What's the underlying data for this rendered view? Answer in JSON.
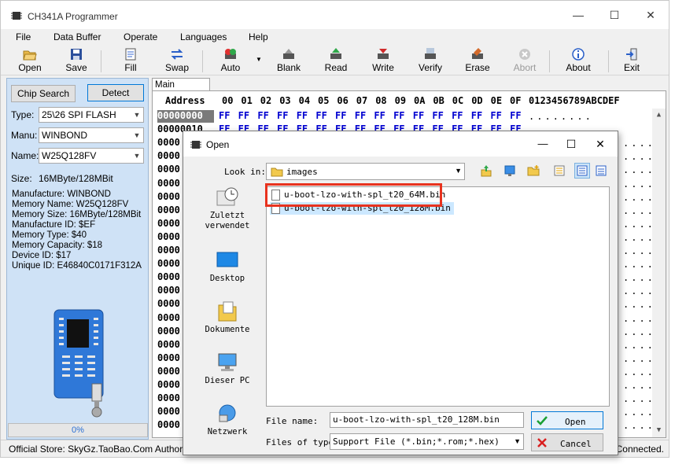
{
  "app": {
    "title": "CH341A Programmer",
    "window_buttons": {
      "minimize": "—",
      "maximize": "☐",
      "close": "✕"
    }
  },
  "menu": [
    "File",
    "Data Buffer",
    "Operate",
    "Languages",
    "Help"
  ],
  "toolbar": [
    {
      "label": "Open",
      "icon": "folder-open-icon",
      "enabled": true
    },
    {
      "label": "Save",
      "icon": "floppy-icon",
      "enabled": true
    },
    {
      "label": "Fill",
      "icon": "fill-icon",
      "enabled": true
    },
    {
      "label": "Swap",
      "icon": "swap-arrows-icon",
      "enabled": true
    },
    {
      "label": "Auto",
      "icon": "auto-chip-icon",
      "enabled": true
    },
    {
      "label": "Blank",
      "icon": "blank-chip-icon",
      "enabled": true
    },
    {
      "label": "Read",
      "icon": "read-chip-icon",
      "enabled": true
    },
    {
      "label": "Write",
      "icon": "write-chip-icon",
      "enabled": true
    },
    {
      "label": "Verify",
      "icon": "verify-chip-icon",
      "enabled": true
    },
    {
      "label": "Erase",
      "icon": "erase-chip-icon",
      "enabled": true
    },
    {
      "label": "Abort",
      "icon": "abort-icon",
      "enabled": false
    },
    {
      "label": "About",
      "icon": "info-icon",
      "enabled": true
    },
    {
      "label": "Exit",
      "icon": "exit-icon",
      "enabled": true
    }
  ],
  "left_panel": {
    "chip_search": "Chip Search",
    "detect": "Detect",
    "type_label": "Type:",
    "type_value": "25\\26 SPI FLASH",
    "manu_label": "Manu:",
    "manu_value": "WINBOND",
    "name_label": "Name:",
    "name_value": "W25Q128FV",
    "size_label": "Size:",
    "size_value": "16MByte/128MBit",
    "info_lines": [
      "Manufacture: WINBOND",
      "Memory Name: W25Q128FV",
      "Memory Size: 16MByte/128MBit",
      "Manufacture ID: $EF",
      "Memory Type: $40",
      "Memory Capacity: $18",
      "Device ID: $17",
      "Unique ID: E46840C0171F312A"
    ],
    "progress_text": "0%",
    "progress_value": 0
  },
  "hex": {
    "tab": "Main Memory",
    "address_header": "Address",
    "columns": [
      "00",
      "01",
      "02",
      "03",
      "04",
      "05",
      "06",
      "07",
      "08",
      "09",
      "0A",
      "0B",
      "0C",
      "0D",
      "0E",
      "0F"
    ],
    "ascii_header": "0123456789ABCDEF",
    "rows": [
      {
        "addr": "00000000",
        "bytes": "FF FF FF FF FF FF FF FF FF FF FF FF FF FF FF FF",
        "ascii": "........"
      },
      {
        "addr": "00000010",
        "bytes": "FF FF FF FF FF FF FF FF FF FF FF FF FF FF FF FF",
        "ascii": "........"
      },
      {
        "addr": "0000",
        "bytes": "",
        "ascii": "....."
      },
      {
        "addr": "0000",
        "bytes": "",
        "ascii": "....."
      },
      {
        "addr": "0000",
        "bytes": "",
        "ascii": "....."
      },
      {
        "addr": "0000",
        "bytes": "",
        "ascii": "....."
      },
      {
        "addr": "0000",
        "bytes": "",
        "ascii": "....."
      },
      {
        "addr": "0000",
        "bytes": "",
        "ascii": "....."
      },
      {
        "addr": "0000",
        "bytes": "",
        "ascii": "....."
      },
      {
        "addr": "0000",
        "bytes": "",
        "ascii": "....."
      },
      {
        "addr": "0000",
        "bytes": "",
        "ascii": "....."
      },
      {
        "addr": "0000",
        "bytes": "",
        "ascii": "....."
      },
      {
        "addr": "0000",
        "bytes": "",
        "ascii": "....."
      },
      {
        "addr": "0000",
        "bytes": "",
        "ascii": "....."
      },
      {
        "addr": "0000",
        "bytes": "",
        "ascii": "....."
      },
      {
        "addr": "0000",
        "bytes": "",
        "ascii": "....."
      },
      {
        "addr": "0000",
        "bytes": "",
        "ascii": "....."
      },
      {
        "addr": "0000",
        "bytes": "",
        "ascii": "....."
      },
      {
        "addr": "0000",
        "bytes": "",
        "ascii": "....."
      },
      {
        "addr": "0000",
        "bytes": "",
        "ascii": "....."
      },
      {
        "addr": "0000",
        "bytes": "",
        "ascii": "....."
      },
      {
        "addr": "0000",
        "bytes": "",
        "ascii": "....."
      },
      {
        "addr": "0000",
        "bytes": "",
        "ascii": "....."
      },
      {
        "addr": "0000",
        "bytes": "",
        "ascii": "....."
      }
    ]
  },
  "status": {
    "left": "Official Store: SkyGz.TaoBao.Com Author: Cam",
    "right": "Connected."
  },
  "dialog": {
    "title": "Open",
    "look_in_label": "Look in:",
    "look_in_value": "images",
    "places": [
      "Zuletzt\nverwendet",
      "Desktop",
      "Dokumente",
      "Dieser PC",
      "Netzwerk"
    ],
    "files": [
      "u-boot-lzo-with-spl_t20_64M.bin",
      "u-boot-lzo-with-spl_t20_128M.bin"
    ],
    "file_name_label": "File name:",
    "file_name_value": "u-boot-lzo-with-spl_t20_128M.bin",
    "file_type_label": "Files of type",
    "file_type_value": "Support File (*.bin;*.rom;*.hex)",
    "open_button": "Open",
    "cancel_button": "Cancel",
    "highlight_color": "#e8321e",
    "selected_color": "#cce8ff"
  }
}
